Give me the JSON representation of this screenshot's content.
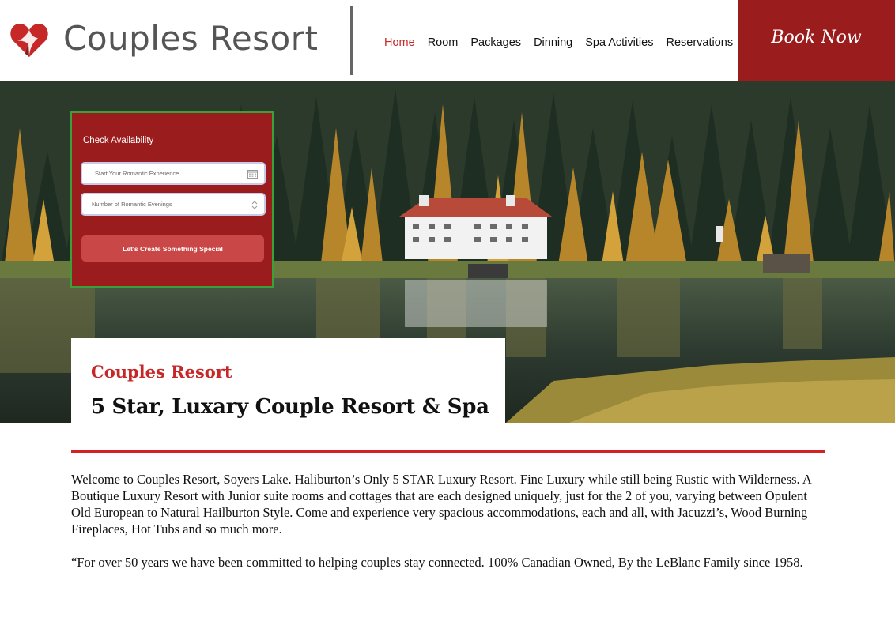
{
  "header": {
    "brand": "Couples Resort",
    "logo_icon": "heart-logo-icon",
    "book_now_label": "Book Now",
    "nav": [
      {
        "label": "Home",
        "active": true
      },
      {
        "label": "Room",
        "active": false
      },
      {
        "label": "Packages",
        "active": false
      },
      {
        "label": "Dinning",
        "active": false
      },
      {
        "label": "Spa Activities",
        "active": false
      },
      {
        "label": "Reservations",
        "active": false
      }
    ]
  },
  "availability": {
    "title": "Check Availability",
    "date_placeholder": "Start Your Romantic Experience",
    "date_icon": "calendar-icon",
    "nights_placeholder": "Number of Romantic Evenings",
    "nights_icon": "stepper-icon",
    "submit_label": "Let's Create Something Special"
  },
  "hero_card": {
    "name": "Couples Resort",
    "tagline": "5 Star, Luxary Couple Resort & Spa"
  },
  "body": {
    "paragraphs": [
      "Welcome to Couples Resort, Soyers Lake.  Haliburton’s Only 5 STAR Luxury Resort.  Fine Luxury while still being Rustic with Wilderness.  A Boutique Luxury Resort with Junior suite rooms and cottages that are each designed uniquely, just for the 2 of you, varying between Opulent Old European to Natural Hailburton Style.  Come and experience very spacious accommodations, each and all, with Jacuzzi’s, Wood Burning Fireplaces, Hot Tubs and so much more.",
      "“For over 50 years we have been committed to helping couples stay connected. 100% Canadian Owned, By the LeBlanc Family since 1958."
    ]
  },
  "colors": {
    "brand_red": "#9b1c1c",
    "accent_red": "#c62828",
    "button_red": "#c94747"
  }
}
